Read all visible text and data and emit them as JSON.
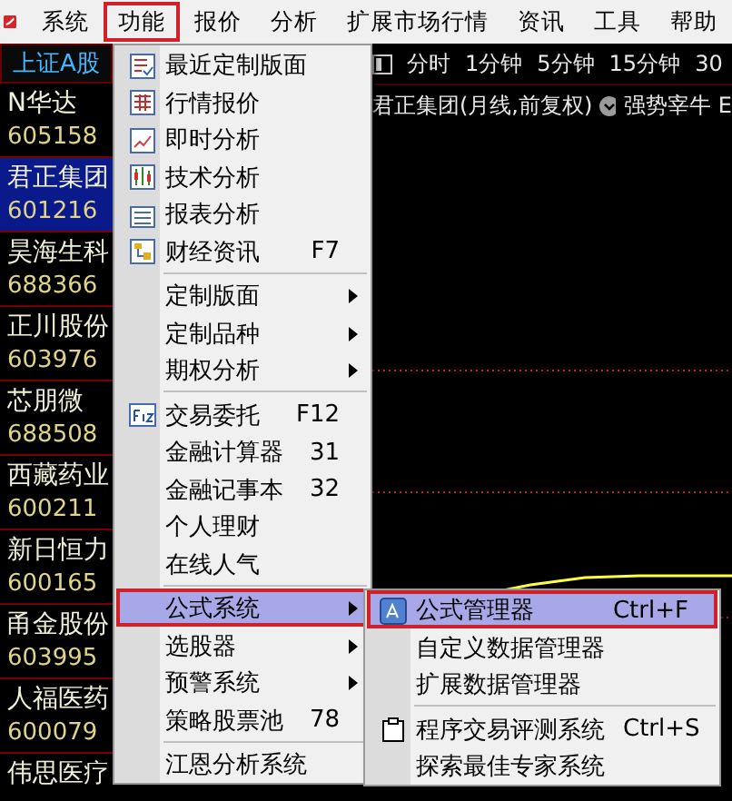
{
  "menubar": {
    "items": [
      {
        "label": "系统",
        "selected": false
      },
      {
        "label": "功能",
        "selected": true
      },
      {
        "label": "报价",
        "selected": false
      },
      {
        "label": "分析",
        "selected": false
      },
      {
        "label": "扩展市场行情",
        "selected": false
      },
      {
        "label": "资讯",
        "selected": false
      },
      {
        "label": "工具",
        "selected": false
      },
      {
        "label": "帮助",
        "selected": false
      }
    ]
  },
  "stock_list": {
    "header": "上证A股",
    "rows": [
      {
        "name": "N华达",
        "code": "605158",
        "selected": false
      },
      {
        "name": "君正集团",
        "code": "601216",
        "selected": true
      },
      {
        "name": "昊海生科",
        "code": "688366",
        "selected": false
      },
      {
        "name": "正川股份",
        "code": "603976",
        "selected": false
      },
      {
        "name": "芯朋微",
        "code": "688508",
        "selected": false
      },
      {
        "name": "西藏药业",
        "code": "600211",
        "selected": false
      },
      {
        "name": "新日恒力",
        "code": "600165",
        "selected": false
      },
      {
        "name": "甬金股份",
        "code": "603995",
        "selected": false
      },
      {
        "name": "人福医药",
        "code": "600079",
        "selected": false
      },
      {
        "name": "伟思医疗",
        "selected": false
      }
    ]
  },
  "chart": {
    "periods": [
      "分时",
      "1分钟",
      "5分钟",
      "15分钟",
      "30"
    ],
    "title": "君正集团(月线,前复权)",
    "indicator": "强势宰牛",
    "cut_text": "E"
  },
  "menu": {
    "items": [
      {
        "kind": "item",
        "label": "最近定制版面",
        "icon": true,
        "submenu": false,
        "selected": false
      },
      {
        "kind": "item",
        "label": "行情报价",
        "icon": true,
        "submenu": false,
        "selected": false
      },
      {
        "kind": "item",
        "label": "即时分析",
        "icon": true,
        "submenu": false,
        "selected": false
      },
      {
        "kind": "item",
        "label": "技术分析",
        "icon": true,
        "submenu": false,
        "selected": false
      },
      {
        "kind": "item",
        "label": "报表分析",
        "icon": true,
        "submenu": false,
        "selected": false
      },
      {
        "kind": "item",
        "label": "财经资讯",
        "shortcut": "F7",
        "icon": true,
        "submenu": false,
        "selected": false
      },
      {
        "kind": "separator"
      },
      {
        "kind": "item",
        "label": "定制版面",
        "icon": false,
        "submenu": true,
        "selected": false
      },
      {
        "kind": "item",
        "label": "定制品种",
        "icon": false,
        "submenu": true,
        "selected": false
      },
      {
        "kind": "item",
        "label": "期权分析",
        "icon": false,
        "submenu": true,
        "selected": false
      },
      {
        "kind": "separator"
      },
      {
        "kind": "item",
        "label": "交易委托",
        "shortcut": "F12",
        "icon": true,
        "submenu": false,
        "selected": false
      },
      {
        "kind": "item",
        "label": "金融计算器",
        "shortcut": "31",
        "icon": false,
        "submenu": false,
        "selected": false
      },
      {
        "kind": "item",
        "label": "金融记事本",
        "shortcut": "32",
        "icon": false,
        "submenu": false,
        "selected": false
      },
      {
        "kind": "item",
        "label": "个人理财",
        "icon": false,
        "submenu": false,
        "selected": false
      },
      {
        "kind": "item",
        "label": "在线人气",
        "icon": false,
        "submenu": false,
        "selected": false
      },
      {
        "kind": "separator"
      },
      {
        "kind": "item",
        "label": "公式系统",
        "icon": false,
        "submenu": true,
        "selected": true
      },
      {
        "kind": "item",
        "label": "选股器",
        "icon": false,
        "submenu": true,
        "selected": false
      },
      {
        "kind": "item",
        "label": "预警系统",
        "icon": false,
        "submenu": true,
        "selected": false
      },
      {
        "kind": "item",
        "label": "策略股票池",
        "shortcut": "78",
        "icon": false,
        "submenu": false,
        "selected": false
      },
      {
        "kind": "separator"
      },
      {
        "kind": "item",
        "label": "江恩分析系统",
        "icon": false,
        "submenu": false,
        "selected": false
      }
    ]
  },
  "submenu": {
    "items": [
      {
        "kind": "item",
        "label": "公式管理器",
        "shortcut": "Ctrl+F",
        "icon": true,
        "submenu": false,
        "selected": true
      },
      {
        "kind": "item",
        "label": "自定义数据管理器",
        "icon": false,
        "submenu": false,
        "selected": false
      },
      {
        "kind": "item",
        "label": "扩展数据管理器",
        "icon": false,
        "submenu": false,
        "selected": false
      },
      {
        "kind": "separator"
      },
      {
        "kind": "item",
        "label": "程序交易评测系统",
        "shortcut": "Ctrl+S",
        "icon": true,
        "submenu": false,
        "selected": false
      },
      {
        "kind": "item",
        "label": "探索最佳专家系统",
        "icon": false,
        "submenu": false,
        "selected": false
      }
    ]
  }
}
